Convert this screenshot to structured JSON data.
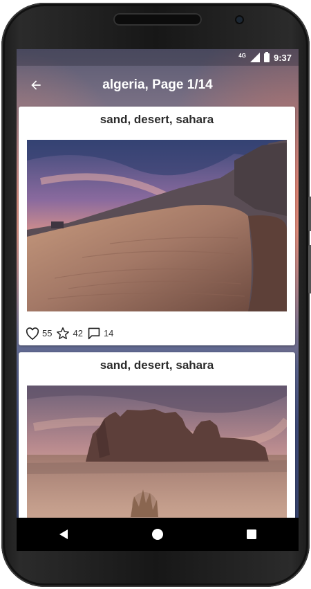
{
  "status_bar": {
    "network": "4G",
    "time": "9:37"
  },
  "app_bar": {
    "title": "algeria, Page 1/14",
    "back_icon": "arrow-back-icon"
  },
  "cards": [
    {
      "title": "sand, desert, sahara",
      "image": "desert-dunes-sunset-photo",
      "likes": "55",
      "favorites": "42",
      "comments": "14"
    },
    {
      "title": "sand, desert, sahara",
      "image": "desert-rock-formation-photo"
    }
  ],
  "nav_bar": {
    "back": "nav-back-icon",
    "home": "nav-home-icon",
    "recents": "nav-recents-icon"
  },
  "colors": {
    "card_background": "#ffffff",
    "text": "#2b2b2b",
    "nav_background": "#000000"
  }
}
